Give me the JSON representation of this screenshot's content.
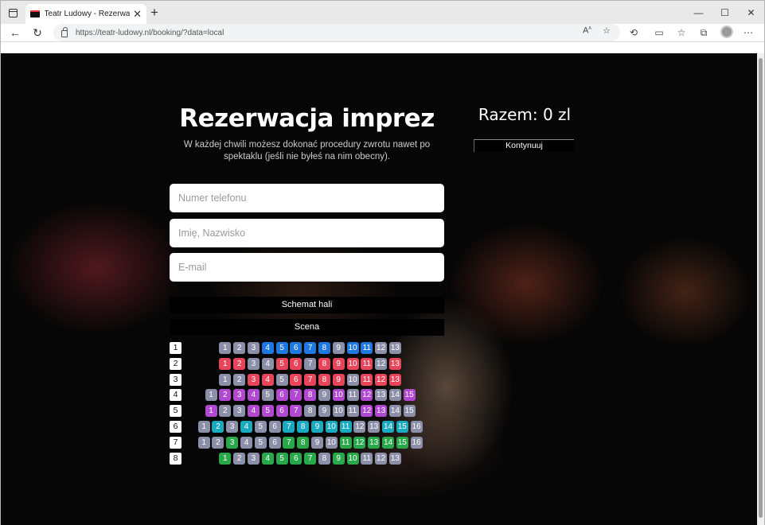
{
  "browser": {
    "tab_title": "Teatr Ludowy - Rezerwacja impre",
    "url": "https://teatr-ludowy.nl/booking/?data=local"
  },
  "page": {
    "title": "Rezerwacja imprez",
    "subtitle_line1": "W każdej chwili możesz dokonać procedury zwrotu nawet po",
    "subtitle_line2": "spektaklu (jeśli nie byłeś na nim obecny).",
    "total": "Razem: 0 zl",
    "continue_label": "Kontynuuj",
    "phone_placeholder": "Numer telefonu",
    "name_placeholder": "Imię, Nazwisko",
    "email_placeholder": "E-mail",
    "hall_scheme_label": "Schemat hali",
    "stage_label": "Scena"
  },
  "colors": {
    "grey": "#8c8fa8",
    "blue": "#1f78e0",
    "red": "#e8455a",
    "purple": "#b048d0",
    "teal": "#1aaac0",
    "green": "#28a84a"
  },
  "rows": [
    {
      "label": "1",
      "seats": [
        "grey",
        "grey",
        "grey",
        "blue",
        "blue",
        "blue",
        "blue",
        "blue",
        "grey",
        "blue",
        "blue",
        "grey",
        "grey"
      ]
    },
    {
      "label": "2",
      "seats": [
        "red",
        "red",
        "grey",
        "grey",
        "red",
        "red",
        "grey",
        "red",
        "red",
        "red",
        "red",
        "grey",
        "red"
      ]
    },
    {
      "label": "3",
      "seats": [
        "grey",
        "grey",
        "red",
        "red",
        "grey",
        "red",
        "red",
        "red",
        "red",
        "grey",
        "red",
        "red",
        "red"
      ]
    },
    {
      "label": "4",
      "seats": [
        "grey",
        "purple",
        "purple",
        "purple",
        "grey",
        "purple",
        "purple",
        "purple",
        "grey",
        "purple",
        "grey",
        "purple",
        "grey",
        "grey",
        "purple"
      ]
    },
    {
      "label": "5",
      "seats": [
        "purple",
        "grey",
        "grey",
        "purple",
        "purple",
        "purple",
        "purple",
        "grey",
        "grey",
        "grey",
        "grey",
        "purple",
        "purple",
        "grey",
        "grey"
      ]
    },
    {
      "label": "6",
      "seats": [
        "grey",
        "teal",
        "grey",
        "teal",
        "grey",
        "grey",
        "teal",
        "teal",
        "teal",
        "teal",
        "teal",
        "grey",
        "grey",
        "teal",
        "teal",
        "grey"
      ]
    },
    {
      "label": "7",
      "seats": [
        "grey",
        "grey",
        "green",
        "grey",
        "grey",
        "grey",
        "green",
        "green",
        "grey",
        "grey",
        "green",
        "green",
        "green",
        "green",
        "green",
        "grey"
      ]
    },
    {
      "label": "8",
      "seats": [
        "green",
        "grey",
        "grey",
        "green",
        "green",
        "green",
        "green",
        "grey",
        "green",
        "green",
        "grey",
        "grey",
        "grey"
      ]
    }
  ]
}
